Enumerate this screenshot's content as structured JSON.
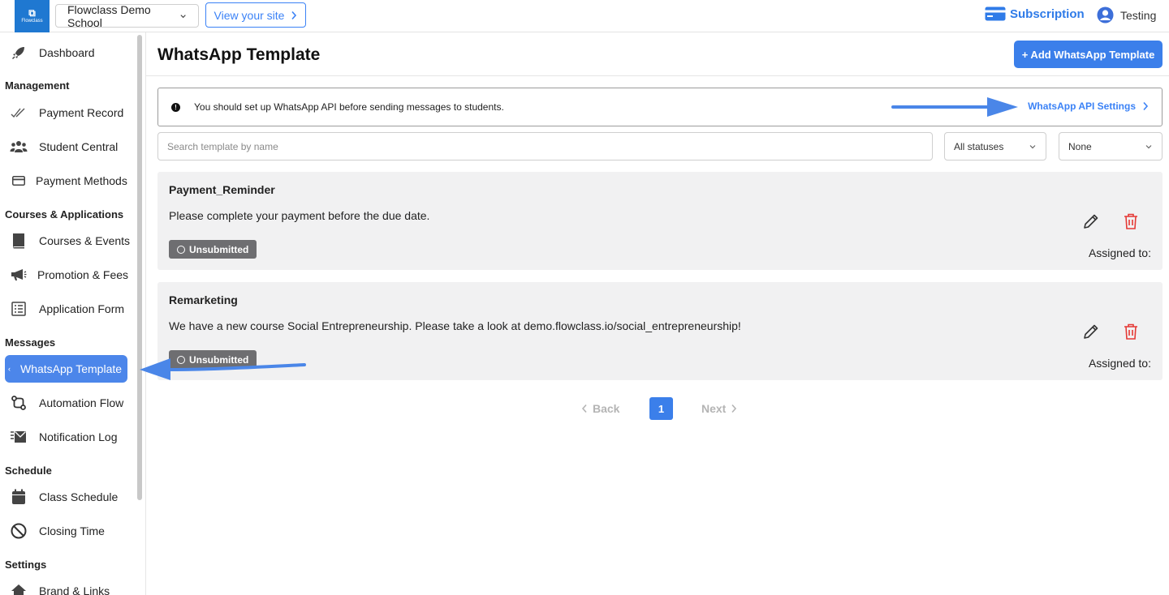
{
  "topbar": {
    "logo_text": "Flowclass",
    "school_name": "Flowclass Demo School",
    "view_site": "View your site",
    "subscription": "Subscription",
    "user_name": "Testing"
  },
  "sidebar": {
    "items": {
      "dashboard": "Dashboard",
      "payment_record": "Payment Record",
      "student_central": "Student Central",
      "payment_methods": "Payment Methods",
      "courses_events": "Courses & Events",
      "promotion_fees": "Promotion & Fees",
      "application_form": "Application Form",
      "whatsapp_template": "WhatsApp Template",
      "automation_flow": "Automation Flow",
      "notification_log": "Notification Log",
      "class_schedule": "Class Schedule",
      "closing_time": "Closing Time",
      "brand_links": "Brand & Links"
    },
    "headings": {
      "management": "Management",
      "courses_applications": "Courses & Applications",
      "messages": "Messages",
      "schedule": "Schedule",
      "settings": "Settings"
    }
  },
  "main": {
    "title": "WhatsApp Template",
    "add_button": "+ Add WhatsApp Template",
    "notice": "You should set up WhatsApp API before sending messages to students.",
    "notice_icon": "!",
    "api_settings": "WhatsApp API Settings",
    "search_placeholder": "Search template by name",
    "status_filter": "All statuses",
    "secondary_filter": "None",
    "templates": [
      {
        "name": "Payment_Reminder",
        "body": "Please complete your payment before the due date.",
        "status": "Unsubmitted",
        "assigned": "Assigned to:"
      },
      {
        "name": "Remarketing",
        "body": "We have a new course Social Entrepreneurship. Please take a look at demo.flowclass.io/social_entrepreneurship!",
        "status": "Unsubmitted",
        "assigned": "Assigned to:"
      }
    ],
    "pagination": {
      "back": "Back",
      "current": "1",
      "next": "Next"
    }
  },
  "colors": {
    "accent": "#3b7fea",
    "badge": "#6e6e71",
    "delete": "#e53935",
    "card_bg": "#f1f1f2"
  }
}
